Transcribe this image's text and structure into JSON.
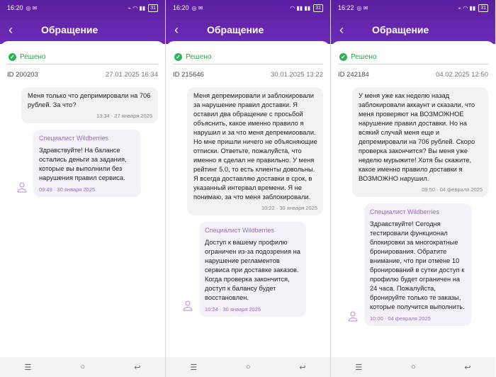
{
  "screens": [
    {
      "status": {
        "time": "16:20",
        "battery": "31"
      },
      "title": "Обращение",
      "resolved_label": "Решено",
      "ticket_id": "ID 200203",
      "ticket_date": "27.01.2025 16:34",
      "user_message": {
        "text": "Меня только что депримировали на 706 рублей. За что?",
        "time": "13:34 · 27 января 2025"
      },
      "agent_message": {
        "author": "Специалист Wildberries",
        "text": "Здравствуйте! На балансе остались деньги за задания, которые вы выполнили без нарушения правил сервиса.",
        "time": "09:49 · 30 января 2025"
      }
    },
    {
      "status": {
        "time": "16:20",
        "battery": "31"
      },
      "title": "Обращение",
      "resolved_label": "Решено",
      "ticket_id": "ID 215646",
      "ticket_date": "30.01.2025 13:22",
      "user_message": {
        "text": "Меня депремировали и заблокировали за нарушение правил доставки. Я оставил два обращение с просьбой объяснить, какое именно правило я нарушил и за что меня депремиоовали. Но мне пришли ничего не объясняющие отписки. Ответьте, пожалуйста, что именно я сделал не правильно. У меня рейтинг 5.0, то есть клиенты довольны. Я всегда доставляю доставки в срок, в указанный интервал времени. Я не понимаю, за что меня заблокировали.",
        "time": "10:22 · 30 января 2025"
      },
      "agent_message": {
        "author": "Специалист Wildberries",
        "text": "Доступ к вашему профилю ограничен из-за подозрения на нарушение регламентов сервиса при доставке заказов. Когда проверка закончится, доступ к балансу будет восстановлен.",
        "time": "10:24 · 30 января 2025"
      }
    },
    {
      "status": {
        "time": "16:22",
        "battery": "31"
      },
      "title": "Обращение",
      "resolved_label": "Решено",
      "ticket_id": "ID 242184",
      "ticket_date": "04.02.2025 12:50",
      "user_message": {
        "text": "У меня уже как неделю назад заблокировали аккаунт и сказали, что меня проверяют на ВОЗМОЖНОЕ нарушение правил доставки. Но на всякий случай меня еще и депремировали на 706 рублей. Скоро проверка закончится? Вы меня уже неделю мурыжите! Хотя бы скажите, какое именно правило доставки я ВОЗМОЖНО нарушил.",
        "time": "09:50 · 04 февраля 2025"
      },
      "agent_message": {
        "author": "Специалист Wildberries",
        "text": "Здравствуйте! Сегодня тестировали функционал блокировки за многократные бронирования. Обратите внимание, что при отмене 10 бронирований в сутки доступ к профилю будет ограничен на 24 часа. Пожалуйста, бронируйте только те заказы, которые получится выполнить.",
        "time": "10:00 · 04 февраля 2025"
      }
    }
  ],
  "nav_icons": [
    "menu-icon",
    "home-icon",
    "back-nav-icon"
  ],
  "colors": {
    "header": "#6d2bb8",
    "resolved": "#2e9e50",
    "agent_accent": "#9b6cc9"
  }
}
